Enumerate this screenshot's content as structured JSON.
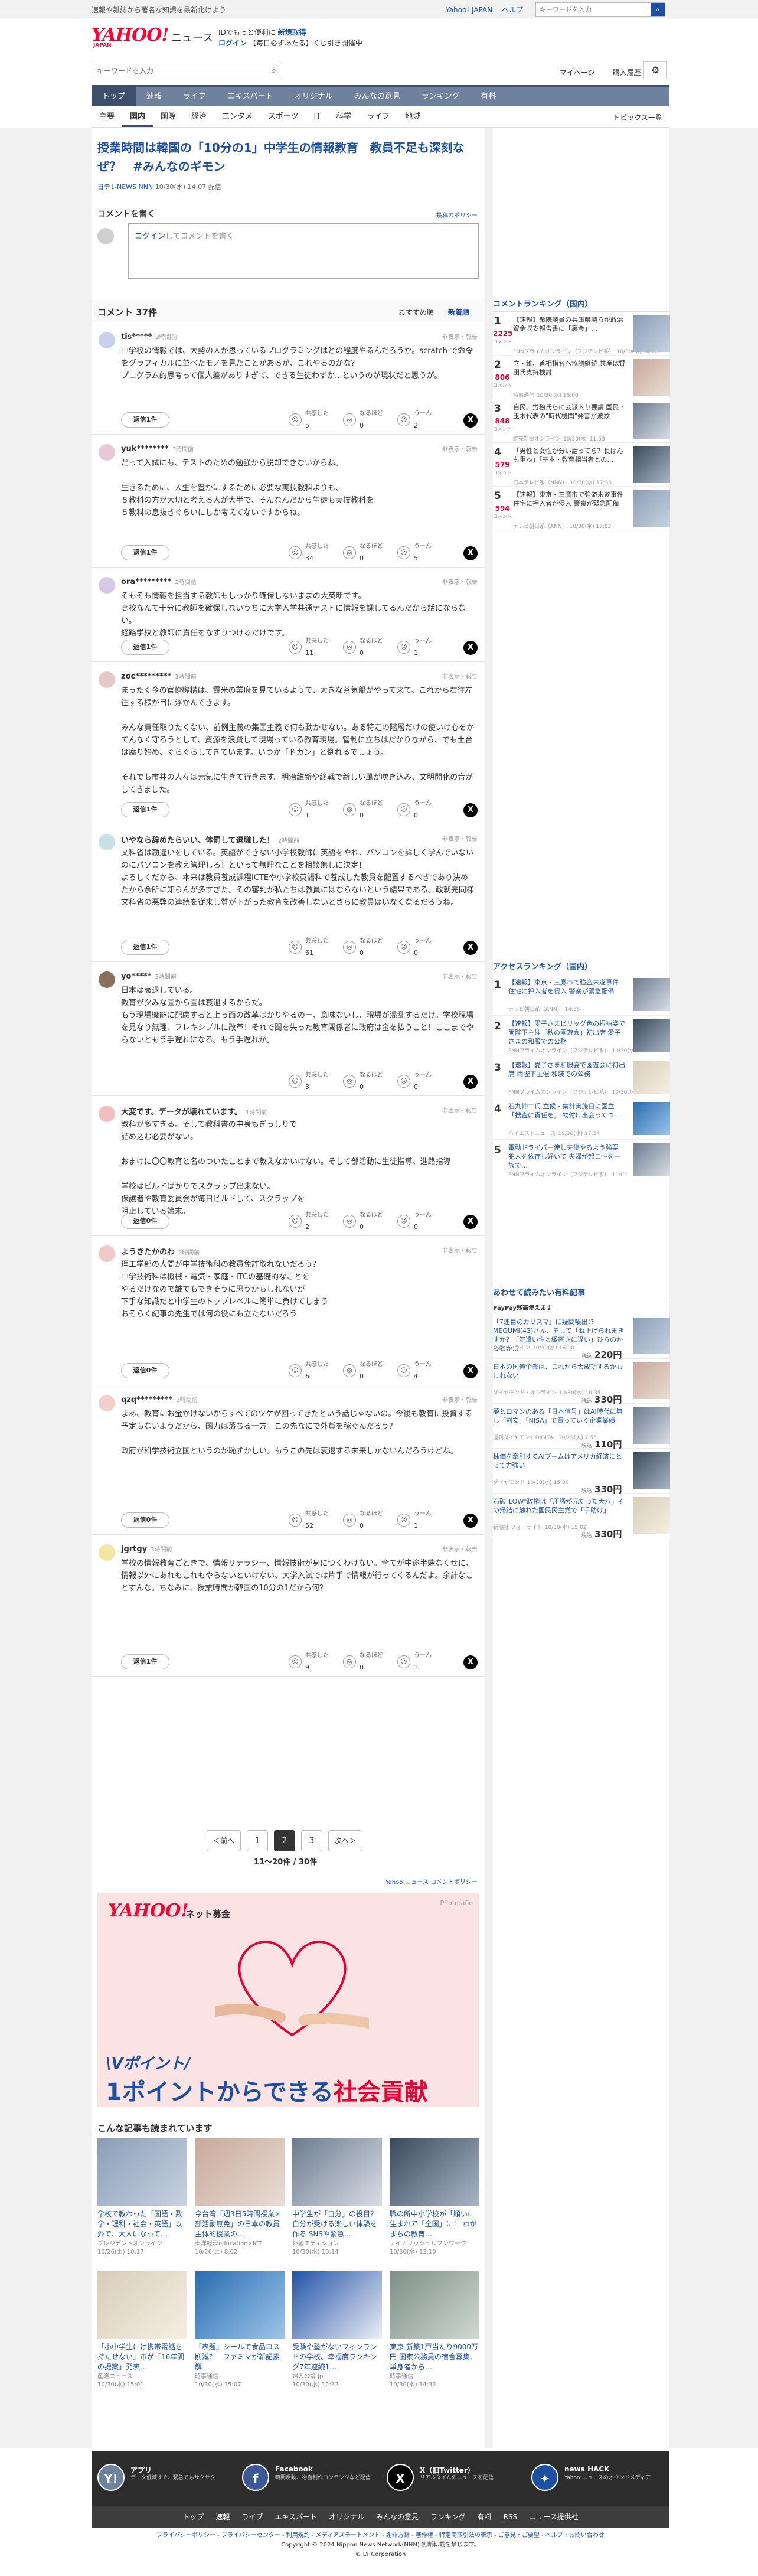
{
  "top": {
    "intro": "速報や雑誌から著名な知識を最新化けよう",
    "links": [
      "Yahoo! JAPAN",
      "ヘルプ"
    ],
    "search_placeholder": "キーワードを入力"
  },
  "header": {
    "logo": "YAHOO!",
    "logo_sub": "JAPAN",
    "news": "ニュース",
    "promo_a": "IDでもっと便利に",
    "promo_b": "新規取得",
    "promo_c_link": "ログイン",
    "promo_d": "【毎日必ずあたる】くじ引き開催中"
  },
  "search": {
    "placeholder": "キーワードを入力",
    "mypage": "マイページ",
    "history": "購入履歴"
  },
  "gnav": [
    "トップ",
    "速報",
    "ライブ",
    "エキスパート",
    "オリジナル",
    "みんなの意見",
    "ランキング",
    "有料"
  ],
  "snav": [
    "主要",
    "国内",
    "国際",
    "経済",
    "エンタメ",
    "スポーツ",
    "IT",
    "科学",
    "ライフ",
    "地域"
  ],
  "snav_right": "トピックス一覧",
  "article": {
    "title": "授業時間は韓国の「10分の1」中学生の情報教育　教員不足も深刻なぜ？　#みんなのギモン",
    "source": "日テレNEWS NNN",
    "date": "10/30(水) 14:07 配信"
  },
  "comment_form": {
    "heading": "コメントを書く",
    "policy": "投稿のポリシー",
    "login": "ログイン",
    "suffix": "してコメントを書く"
  },
  "comment_list": {
    "title": "コメント 37件",
    "sort_recommend": "おすすめ順",
    "sort_new": "新着順"
  },
  "labels": {
    "report": "非表示・報告",
    "empathy": "共感した",
    "understand": "なるほど",
    "hmm": "うーん",
    "replies_suffix": "件"
  },
  "comments": [
    {
      "user": "tis*****",
      "time": "2時間前",
      "body": "中学校の情報では、大勢の人が思っているプログラミングはどの程度やるんだろうか。scratch で命令をグラフィカルに並べたモノを見たことがあるが、これやるのかな？\nプログラム的思考って個人差がありすぎて、できる生徒わずか...というのが現状だと思うが。",
      "replies": "返信1件",
      "e": "5",
      "u": "0",
      "h": "2"
    },
    {
      "user": "yuk********",
      "time": "3時間前",
      "body": "だって入試にも、テストのための勉強から脱却できないからね。\n\n生きるために、人生を豊かにするために必要な実技教科よりも、\n５教科の方が大切と考える人が大半で、そんなんだから生徒も実技教科を\n５教科の息抜きぐらいにしか考えてないですからね。",
      "replies": "返信1件",
      "e": "34",
      "u": "0",
      "h": "5"
    },
    {
      "user": "ora*********",
      "time": "2時間前",
      "body": "そもそも情報を担当する教師もしっかり確保しないままの大英断です。\n高校なんて十分に教師を確保しないうちに大学入学共通テストに情報を課してるんだから話にならない。\n経路学校と教師に責任をなすりつけるだけです。",
      "replies": "返信1件",
      "e": "11",
      "u": "0",
      "h": "1"
    },
    {
      "user": "zoc*********",
      "time": "3時間前",
      "body": "まったく今の官僚機構は、霞米の業府を見ているようで、大きな茶気船がやって来て、これから右往左往する様が目に浮かんできます。\n\nみんな責任取りたくない、前例主義の集団主義で何も動かせない。ある特定の階層だけの使いけ心をかてんなく守ろうとして、資源を浪費して現場っている教育現場。管制に立ちはだかりながら、でも土台は腐り始め、ぐらぐらしてきています。いつか「ドカン」と倒れるでしょう。\n\nそれでも市井の人々は元気に生きて行きます。明治維新や終戦で新しい風が吹き込み、文明開化の音がしてきました。",
      "replies": "返信1件",
      "e": "1",
      "u": "0",
      "h": "0"
    },
    {
      "user": "いやなら辞めたらいい、体罰して退職した！",
      "time": "2時間前",
      "body": "文科省は勘違いをしている。英語ができない小学校教師に英語をやれ、パソコンを詳しく学んでいないのにパソコンを教え管理しろ！といって無理なことを相談無しに決定！\nよろしくだから、本来は教員養成課程ICTEや小学校英語科で養成した教員を配置するべきであり決めたから余所に知らんが多すぎた。その審判が私たちは教員にはならないという結果である。政就完同様文科省の悪弊の連続を従来し質が下がった教育を改善しないとさらに教員はいなくなるだろうね。",
      "replies": "返信1件",
      "e": "61",
      "u": "0",
      "h": "0"
    },
    {
      "user": "yo*****",
      "time": "3時間前",
      "body": "日本は衰退している。\n教育が夕みな国から国は衰退するからだ。\nもう現場機能に配慮すると上っ面の改革ばかりやるのー、意味ないし、現場が混乱するだけ。学校現場を見なり無理、フレキシブルに改革！それで聞を失った教育関係者に政府は金を払うこと！ここまでやらないともう手遅れになる。もう手遅れか。",
      "replies": "",
      "e": "3",
      "u": "0",
      "h": "0"
    },
    {
      "user": "大変です。データが壊れています。",
      "time": "1時間前",
      "body": "教科が多すぎる。そして教科書の中身もぎっしりで\n詰め込む必要がない。\n\nおまけに〇〇教育と名のついたことまで教えなかいけない。そして部活動に生徒指導、進路指導\n\n学校はビルドばかりでスクラップ出来ない。\n保護者や教育委員会が毎日ビルドして、スクラップを\n阻止している始末。",
      "replies": "返信0件",
      "e": "2",
      "u": "0",
      "h": "0"
    },
    {
      "user": "ようきたかのわ",
      "time": "2時間前",
      "body": "理工学部の人間が中学技術科の教員免許取れないだろう？\n中学技術科は機械・電気・家庭・ITCの基礎的なことを\nやるだけなので誰でもできそうに思うかもしれないが\n下手な知識だと中学生のトップレベルに簡単に負けてしまう\nおそらく紀事の先生では何の役にも立たないだろう",
      "replies": "返信0件",
      "e": "6",
      "u": "0",
      "h": "4"
    },
    {
      "user": "qzq*********",
      "time": "3時間前",
      "body": "まあ、教育にお金かけないからすべてのツケが回ってきたという話じゃないの。今後も教育に投資する予定もないようだから、国力は落ちる一方。この先なにで外貨を稼ぐんだろう？\n\n政府が科学技術立国というのが恥ずかしい。もうこの先は衰退する未来しかないんだろうけどね。",
      "replies": "返信0件",
      "e": "52",
      "u": "0",
      "h": "1"
    },
    {
      "user": "jgrtgy",
      "time": "3時間前",
      "body": "学校の情報教育ごときで、情報リテラシー、情報技術が身につくわけない。全てが中途半端なくせに、情報以外にあれもこれもやらないといけない、大学入試では片手で情報が行ってくるんだよ。余計なことすんな。ちなみに、授業時間が韓国の10分の1だから何？",
      "replies": "返信1件",
      "e": "9",
      "u": "0",
      "h": "1"
    }
  ],
  "pager": {
    "prev": "＜前へ",
    "pages": [
      "1",
      "2",
      "3"
    ],
    "current": "2",
    "next": "次へ＞",
    "count": "11〜20件 / 30件",
    "policy": "Yahoo!ニュース コメントポリシー"
  },
  "ad": {
    "logo": "YAHOO!",
    "logo_sub": "JAPAN",
    "tag": "ネット募金",
    "photo": "Photo:afio",
    "t1": "\\Vポイント/",
    "t2a": "1ポイントからできる",
    "t2b": "社会貢献"
  },
  "related": {
    "heading": "こんな記事も読まれています",
    "items": [
      {
        "title": "学校で教わった「国語・数学・理科・社会・英語」以外で、大人になって…",
        "src": "プレジデントオンライン",
        "date": "10/26(土) 10:17"
      },
      {
        "title": "今台湾「週3日5時間授業×部活動無免」の日本の教員 主体的授業の…",
        "src": "東洋経済education×ICT",
        "date": "10/26(土) 8:02"
      },
      {
        "title": "中学生が「自分」の役目？自分が受ける楽しい体験を作る SNSや緊急…",
        "src": "外國エディション",
        "date": "10/30(水) 10:14"
      },
      {
        "title": "職の所中小学校が「順いに生まれで「全国」に！ わがまちの教育…",
        "src": "ナイナリッシュルフンワーク",
        "date": "10/30(水) 13:10"
      },
      {
        "title": "「小中学生にけ携帯電話を持たせない」市が「16年間の提案」発表…",
        "src": "産経ニュース",
        "date": "10/30(水) 15:01"
      },
      {
        "title": "「表題」シールで食品ロス削減？　ファミマが新記素解",
        "src": "時事通信",
        "date": "10/30(水) 15:07"
      },
      {
        "title": "受験や塾がないフィンランドの学校、幸福度ランキング7年連続1…",
        "src": "婦人公論.jp",
        "date": "10/30(水) 12:32"
      },
      {
        "title": "東京 新築1戸当たり9000万円 国家公務員の宿舎募集、単身者から…",
        "src": "時事通信",
        "date": "10/30(水) 14:32"
      }
    ]
  },
  "side": {
    "comment_ranking": {
      "heading": "コメントランキング（国内）",
      "count_label": "コメント",
      "items": [
        {
          "n": "1",
          "count": "2225",
          "title": "【速報】衆院議員の兵庫県議らが政治資金収支報告書に「裏金」…",
          "src": "FNNプライムオンライン（フジテレビ系）",
          "date": "10/30(水) 14:20"
        },
        {
          "n": "2",
          "count": "806",
          "title": "立・維、首相指名へ協議継続 共産は野田氏支持検討",
          "src": "時事通信",
          "date": "10/30(水) 16:00"
        },
        {
          "n": "3",
          "count": "848",
          "title": "自民、労務氏らに会派入り要請 国民・玉木代表の\"時代機関\"発言が波紋",
          "src": "読売新聞オンライン",
          "date": "10/30(水) 11:53"
        },
        {
          "n": "4",
          "count": "579",
          "title": "「男性と女性が分い話ってら？長はんも重ね」「基本・教育相当者との…",
          "src": "日本テレビ系（NNN）",
          "date": "10/30(水) 17:36"
        },
        {
          "n": "5",
          "count": "594",
          "title": "【速報】東京・三鷹市で強盗未遂事件 住宅に押入者が侵入 警察が緊急配備",
          "src": "テレビ朝日系（ANN）",
          "date": "10/30(水) 17:03"
        }
      ]
    },
    "access_ranking": {
      "heading": "アクセスランキング（国内）",
      "items": [
        {
          "n": "1",
          "title": "【速報】東京・三鷹市で強盗未遂事件 住宅に押入者を侵入 警察が緊急配備",
          "src": "テレビ朝日系（ANN）",
          "date": "14:55"
        },
        {
          "n": "2",
          "title": "【速報】愛子さまビリッグ色の振袖姿で 両陛下主催「秋の園遊会」初出席 愛子さまの和服での公務",
          "src": "FNNプライムオンライン（フジテレビ系）",
          "date": "10/30(水) 14:04"
        },
        {
          "n": "3",
          "title": "【速報】愛子さま和服姿で園遊会に初出席 両陛下主催 和装での公務",
          "src": "FNNプライムオンライン（フジテレビ系）",
          "date": "10/30(水) 15:38"
        },
        {
          "n": "4",
          "title": "石丸伸二氏 立候・集計実施日に国立「捜査に責任を」 物付け出会ってつ...",
          "src": "ハイエストニュース",
          "date": "10/30(水) 17:34"
        },
        {
          "n": "5",
          "title": "電動ドライバー使し夫傷やるよう強要 犯人を依存し好いて 夫婦が起こ〜を一族で…",
          "src": "FNNプライムオンライン（フジテレビ系）",
          "date": "11:02"
        }
      ]
    },
    "shop": {
      "heading": "あわせて読みたい有料記事",
      "sub": "PayPay残高使えます",
      "price_label": "税込",
      "items": [
        {
          "title": "「7連目のカリスマ」に疑問噴出!? MEGUMI(43)さん、そして「ね上げられまきすか？「気遣い性と緻密さに違い」ひらのかっとか...",
          "src": "文春オンライン",
          "date": "10/30(水) 16:00",
          "price": "220円"
        },
        {
          "title": "日本の国債企業は、これから大成功するかもしれない",
          "src": "ダイヤモンド・オンライン",
          "date": "10/30(水) 10:35",
          "price": "330円"
        },
        {
          "title": "夢とロマンのある「日本信号」はAI時代に無し「割安」「NISA」で買っていく企業業績",
          "src": "週刊ダイヤモンドDIGITAL",
          "date": "10/29(火) 7:55",
          "price": "110円"
        },
        {
          "title": "株価を牽引するAIブームはアメリカ経済にとって力強い",
          "src": "ダイヤモンド",
          "date": "10/30(水) 15:00",
          "price": "330円"
        },
        {
          "title": "石破\"LOW\"政権は「圧勝が元だった大八」その帰結に触れた国民民主党で「手助け」",
          "src": "新潮社 フォーサイト",
          "date": "10/30(水) 15:02",
          "price": "330円"
        }
      ]
    }
  },
  "footer": {
    "items": [
      {
        "title": "アプリ",
        "desc": "データ低減すぐ、緊急でもサクサク",
        "icon": "Y!"
      },
      {
        "title": "Facebook",
        "desc": "時問反動、物自制作コンテンツなど配信",
        "icon": "f"
      },
      {
        "title": "X（旧Twitter）",
        "desc": "リアルタイムのニュースを配信",
        "icon": "X"
      },
      {
        "title": "news HACK",
        "desc": "Yahoo!ニュースのオウンドメディア",
        "icon": "✦"
      }
    ],
    "nav": [
      "トップ",
      "速報",
      "ライブ",
      "エキスパート",
      "オリジナル",
      "みんなの意見",
      "ランキング",
      "有料",
      "RSS",
      "ニュース提供社"
    ],
    "legal1": "プライバシーポリシー - プライバシーセンター - 利用規約 - メディアステートメント - 謝罪方針 - 著作権 - 特定商取引法の表示 - ご意見・ご要望 - ヘルプ・お問い合わせ",
    "legal2": "Copyright © 2024 Nippon News Network(NNN) 無断転載を禁じます。",
    "legal3": "© LY Corporation"
  }
}
